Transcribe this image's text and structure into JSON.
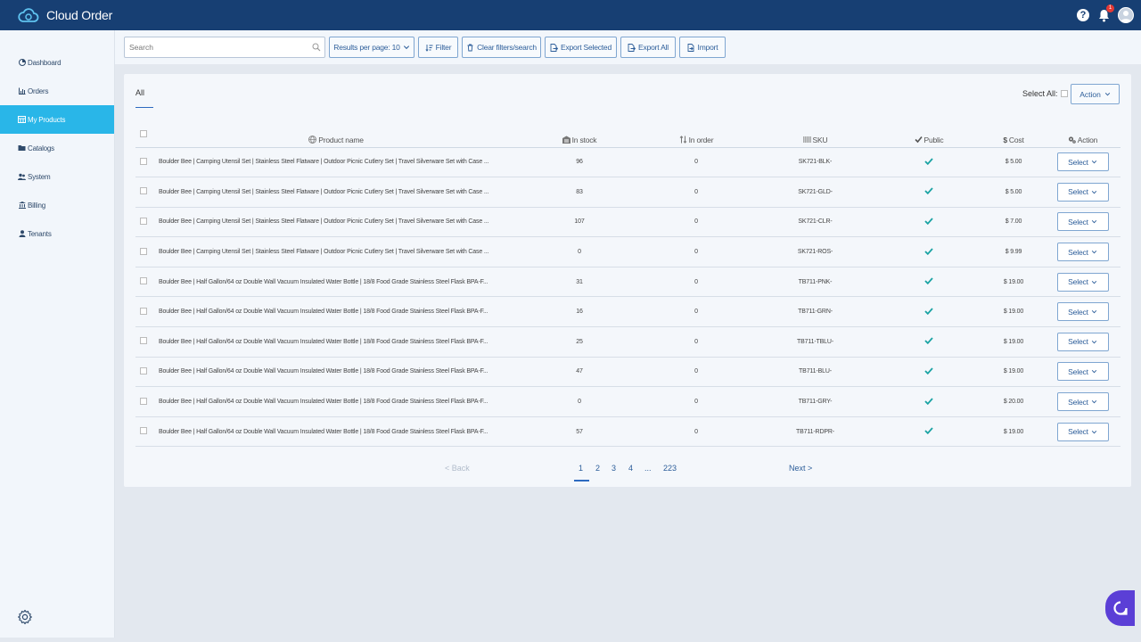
{
  "app": {
    "title": "Cloud Order",
    "notification_count": "1"
  },
  "sidebar": {
    "items": [
      {
        "label": "Dashboard",
        "icon": "dashboard-icon"
      },
      {
        "label": "Orders",
        "icon": "chart-icon"
      },
      {
        "label": "My Products",
        "icon": "products-icon",
        "active": true
      },
      {
        "label": "Catalogs",
        "icon": "folder-icon"
      },
      {
        "label": "System",
        "icon": "users-icon"
      },
      {
        "label": "Billing",
        "icon": "bank-icon"
      },
      {
        "label": "Tenants",
        "icon": "user-icon"
      }
    ]
  },
  "toolbar": {
    "search_placeholder": "Search",
    "results_per_page": "Results per page: 10",
    "filter": "Filter",
    "clear": "Clear filters/search",
    "export_selected": "Export Selected",
    "export_all": "Export All",
    "import": "Import"
  },
  "panel": {
    "tab": "All",
    "select_all": "Select All:",
    "action": "Action"
  },
  "table": {
    "headers": {
      "name": "Product name",
      "stock": "In stock",
      "order": "In order",
      "sku": "SKU",
      "public": "Public",
      "cost": "Cost",
      "action": "Action"
    },
    "select_label": "Select",
    "rows": [
      {
        "name": "Boulder Bee | Camping Utensil Set | Stainless Steel Flatware | Outdoor Picnic Cutlery Set | Travel Silverware Set with Case ...",
        "stock": "96",
        "order": "0",
        "sku": "SK721-BLK-",
        "cost": "$ 5.00"
      },
      {
        "name": "Boulder Bee | Camping Utensil Set | Stainless Steel Flatware | Outdoor Picnic Cutlery Set | Travel Silverware Set with Case ...",
        "stock": "83",
        "order": "0",
        "sku": "SK721-GLD-",
        "cost": "$ 5.00"
      },
      {
        "name": "Boulder Bee | Camping Utensil Set | Stainless Steel Flatware | Outdoor Picnic Cutlery Set | Travel Silverware Set with Case ...",
        "stock": "107",
        "order": "0",
        "sku": "SK721-CLR-",
        "cost": "$ 7.00"
      },
      {
        "name": "Boulder Bee | Camping Utensil Set | Stainless Steel Flatware | Outdoor Picnic Cutlery Set | Travel Silverware Set with Case ...",
        "stock": "0",
        "order": "0",
        "sku": "SK721-ROS-",
        "cost": "$ 9.99"
      },
      {
        "name": "Boulder Bee | Half Gallon/64 oz Double Wall Vacuum Insulated Water Bottle | 18/8 Food Grade Stainless Steel Flask BPA-F...",
        "stock": "31",
        "order": "0",
        "sku": "TB711-PNK-",
        "cost": "$ 19.00"
      },
      {
        "name": "Boulder Bee | Half Gallon/64 oz Double Wall Vacuum Insulated Water Bottle | 18/8 Food Grade Stainless Steel Flask BPA-F...",
        "stock": "16",
        "order": "0",
        "sku": "TB711-GRN-",
        "cost": "$ 19.00"
      },
      {
        "name": "Boulder Bee | Half Gallon/64 oz Double Wall Vacuum Insulated Water Bottle | 18/8 Food Grade Stainless Steel Flask BPA-F...",
        "stock": "25",
        "order": "0",
        "sku": "TB711-TBLU-",
        "cost": "$ 19.00"
      },
      {
        "name": "Boulder Bee | Half Gallon/64 oz Double Wall Vacuum Insulated Water Bottle | 18/8 Food Grade Stainless Steel Flask BPA-F...",
        "stock": "47",
        "order": "0",
        "sku": "TB711-BLU-",
        "cost": "$ 19.00"
      },
      {
        "name": "Boulder Bee | Half Gallon/64 oz Double Wall Vacuum Insulated Water Bottle | 18/8 Food Grade Stainless Steel Flask BPA-F...",
        "stock": "0",
        "order": "0",
        "sku": "TB711-GRY-",
        "cost": "$ 20.00"
      },
      {
        "name": "Boulder Bee | Half Gallon/64 oz Double Wall Vacuum Insulated Water Bottle | 18/8 Food Grade Stainless Steel Flask BPA-F...",
        "stock": "57",
        "order": "0",
        "sku": "TB711-RDPR-",
        "cost": "$ 19.00"
      }
    ]
  },
  "pagination": {
    "back": "< Back",
    "next": "Next >",
    "pages": [
      "1",
      "2",
      "3",
      "4",
      "...",
      "223"
    ],
    "current": "1"
  },
  "colors": {
    "topbar": "#173f73",
    "active_nav": "#29b6e8",
    "accent": "#2d5e9a",
    "check": "#1aa3a3",
    "chat": "#5b3fd6"
  }
}
